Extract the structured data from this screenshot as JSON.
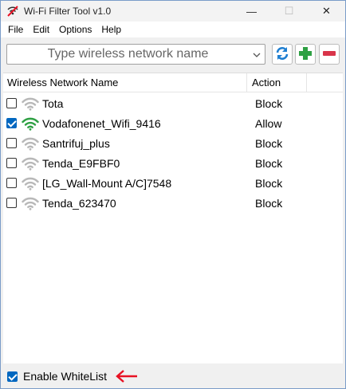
{
  "window": {
    "title": "Wi-Fi Filter Tool v1.0",
    "minimize_glyph": "—",
    "maximize_glyph": "☐",
    "close_glyph": "✕"
  },
  "menu": {
    "items": [
      {
        "label": "File"
      },
      {
        "label": "Edit"
      },
      {
        "label": "Options"
      },
      {
        "label": "Help"
      }
    ]
  },
  "toolbar": {
    "network_input_placeholder": "Type wireless network name",
    "icons": [
      "refresh-icon",
      "add-icon",
      "remove-icon"
    ]
  },
  "list": {
    "columns": {
      "name": "Wireless Network Name",
      "action": "Action"
    },
    "rows": [
      {
        "name": "Tota",
        "action": "Block",
        "checked": false
      },
      {
        "name": "Vodafonenet_Wifi_9416",
        "action": "Allow",
        "checked": true
      },
      {
        "name": "Santrifuj_plus",
        "action": "Block",
        "checked": false
      },
      {
        "name": "Tenda_E9FBF0",
        "action": "Block",
        "checked": false
      },
      {
        "name": "[LG_Wall-Mount A/C]7548",
        "action": "Block",
        "checked": false
      },
      {
        "name": "Tenda_623470",
        "action": "Block",
        "checked": false
      }
    ]
  },
  "footer": {
    "whitelist_label": "Enable WhiteList",
    "whitelist_checked": true
  },
  "colors": {
    "allow_wifi": "#2ea043",
    "block_wifi": "#b8b8b8",
    "accent": "#0067c0",
    "annotation_arrow": "#e81123"
  }
}
